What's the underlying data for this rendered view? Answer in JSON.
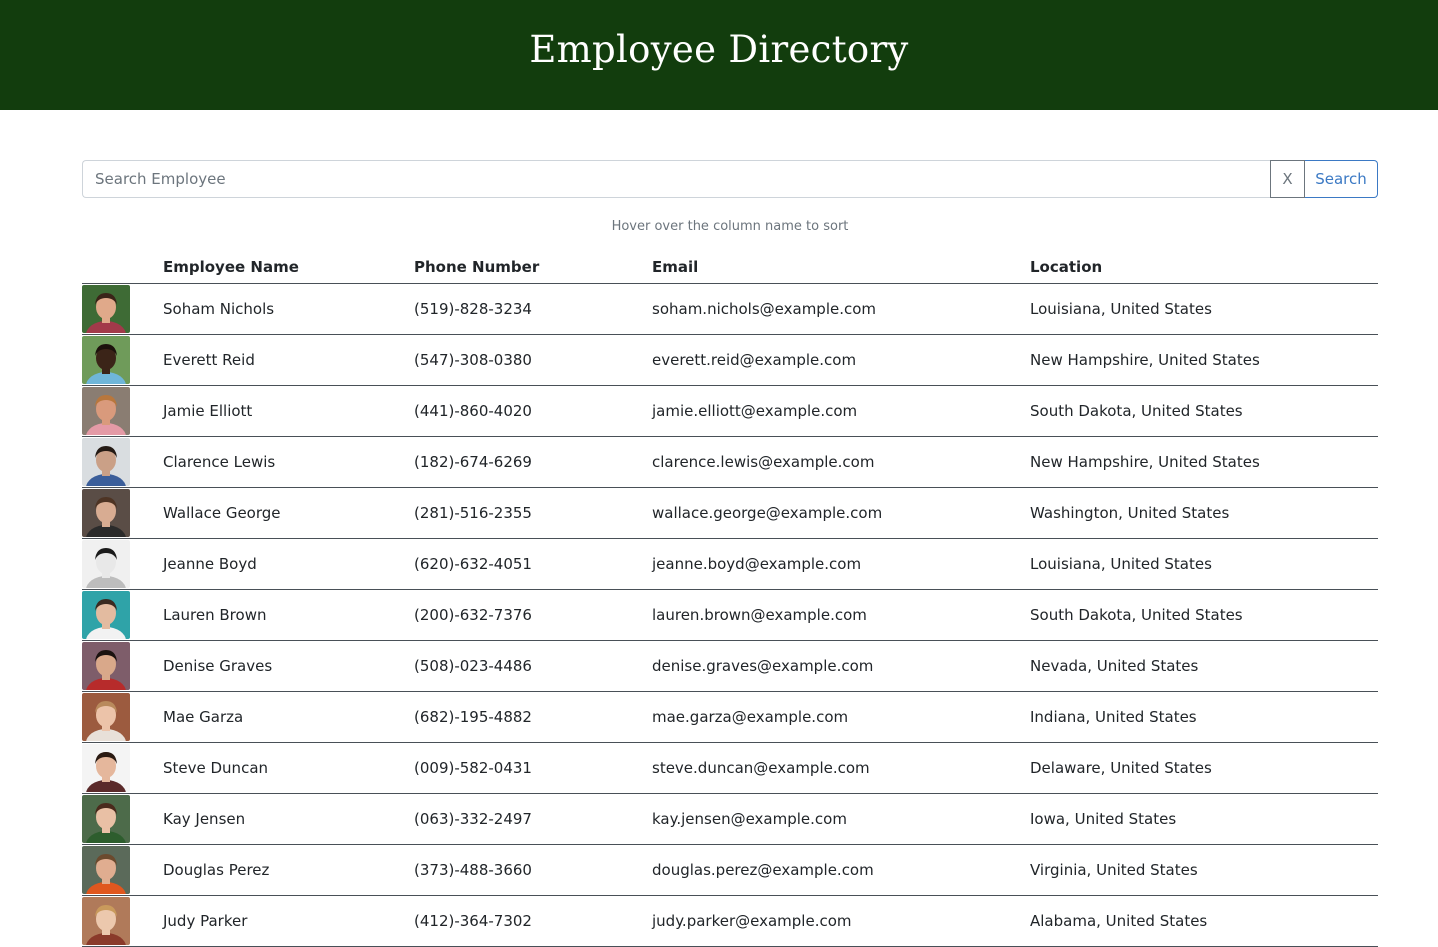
{
  "header": {
    "title": "Employee Directory"
  },
  "search": {
    "placeholder": "Search Employee",
    "value": "",
    "clear_label": "X",
    "submit_label": "Search",
    "hint": "Hover over the column name to sort"
  },
  "table": {
    "columns": [
      "",
      "Employee Name",
      "Phone Number",
      "Email",
      "Location"
    ],
    "rows": [
      {
        "name": "Soham Nichols",
        "phone": "(519)-828-3234",
        "email": "soham.nichols@example.com",
        "location": "Louisiana, United States",
        "avatar": {
          "bg": "#3e6b35",
          "skin": "#e0a98a",
          "hair": "#3a2418",
          "shirt": "#a23a4a"
        }
      },
      {
        "name": "Everett Reid",
        "phone": "(547)-308-0380",
        "email": "everett.reid@example.com",
        "location": "New Hampshire, United States",
        "avatar": {
          "bg": "#6f9b5a",
          "skin": "#3b2418",
          "hair": "#1c120c",
          "shirt": "#6fb6d9"
        }
      },
      {
        "name": "Jamie Elliott",
        "phone": "(441)-860-4020",
        "email": "jamie.elliott@example.com",
        "location": "South Dakota, United States",
        "avatar": {
          "bg": "#8a7d72",
          "skin": "#d99a7c",
          "hair": "#b8773d",
          "shirt": "#e49aa6"
        }
      },
      {
        "name": "Clarence Lewis",
        "phone": "(182)-674-6269",
        "email": "clarence.lewis@example.com",
        "location": "New Hampshire, United States",
        "avatar": {
          "bg": "#d9dde0",
          "skin": "#caa087",
          "hair": "#241a14",
          "shirt": "#3b5e9a"
        }
      },
      {
        "name": "Wallace George",
        "phone": "(281)-516-2355",
        "email": "wallace.george@example.com",
        "location": "Washington, United States",
        "avatar": {
          "bg": "#5a4d46",
          "skin": "#d8ac92",
          "hair": "#4e3424",
          "shirt": "#2b2b2b"
        }
      },
      {
        "name": "Jeanne Boyd",
        "phone": "(620)-632-4051",
        "email": "jeanne.boyd@example.com",
        "location": "Louisiana, United States",
        "avatar": {
          "bg": "#f0f0f0",
          "skin": "#e8e8e8",
          "hair": "#1a1a1a",
          "shirt": "#bdbdbd"
        }
      },
      {
        "name": "Lauren Brown",
        "phone": "(200)-632-7376",
        "email": "lauren.brown@example.com",
        "location": "South Dakota, United States",
        "avatar": {
          "bg": "#2fa3a8",
          "skin": "#e3bba0",
          "hair": "#3a2a20",
          "shirt": "#f2f2f2"
        }
      },
      {
        "name": "Denise Graves",
        "phone": "(508)-023-4486",
        "email": "denise.graves@example.com",
        "location": "Nevada, United States",
        "avatar": {
          "bg": "#7e5d6a",
          "skin": "#d9a88a",
          "hair": "#1b1210",
          "shirt": "#b72b2b"
        }
      },
      {
        "name": "Mae Garza",
        "phone": "(682)-195-4882",
        "email": "mae.garza@example.com",
        "location": "Indiana, United States",
        "avatar": {
          "bg": "#9c5b3f",
          "skin": "#ecc3a9",
          "hair": "#b98a5c",
          "shirt": "#e8e0d8"
        }
      },
      {
        "name": "Steve Duncan",
        "phone": "(009)-582-0431",
        "email": "steve.duncan@example.com",
        "location": "Delaware, United States",
        "avatar": {
          "bg": "#f4f4f4",
          "skin": "#e5b79c",
          "hair": "#2a1a12",
          "shirt": "#5a2a2a"
        }
      },
      {
        "name": "Kay Jensen",
        "phone": "(063)-332-2497",
        "email": "kay.jensen@example.com",
        "location": "Iowa, United States",
        "avatar": {
          "bg": "#4d6b4a",
          "skin": "#e9c0a5",
          "hair": "#4a2a1c",
          "shirt": "#2d5d2d"
        }
      },
      {
        "name": "Douglas Perez",
        "phone": "(373)-488-3660",
        "email": "douglas.perez@example.com",
        "location": "Virginia, United States",
        "avatar": {
          "bg": "#5b6a5a",
          "skin": "#e0ad90",
          "hair": "#6b4a2e",
          "shirt": "#e0571f"
        }
      },
      {
        "name": "Judy Parker",
        "phone": "(412)-364-7302",
        "email": "judy.parker@example.com",
        "location": "Alabama, United States",
        "avatar": {
          "bg": "#b07a5a",
          "skin": "#ecc8ad",
          "hair": "#c99a5c",
          "shirt": "#8a3a2a"
        }
      }
    ]
  }
}
